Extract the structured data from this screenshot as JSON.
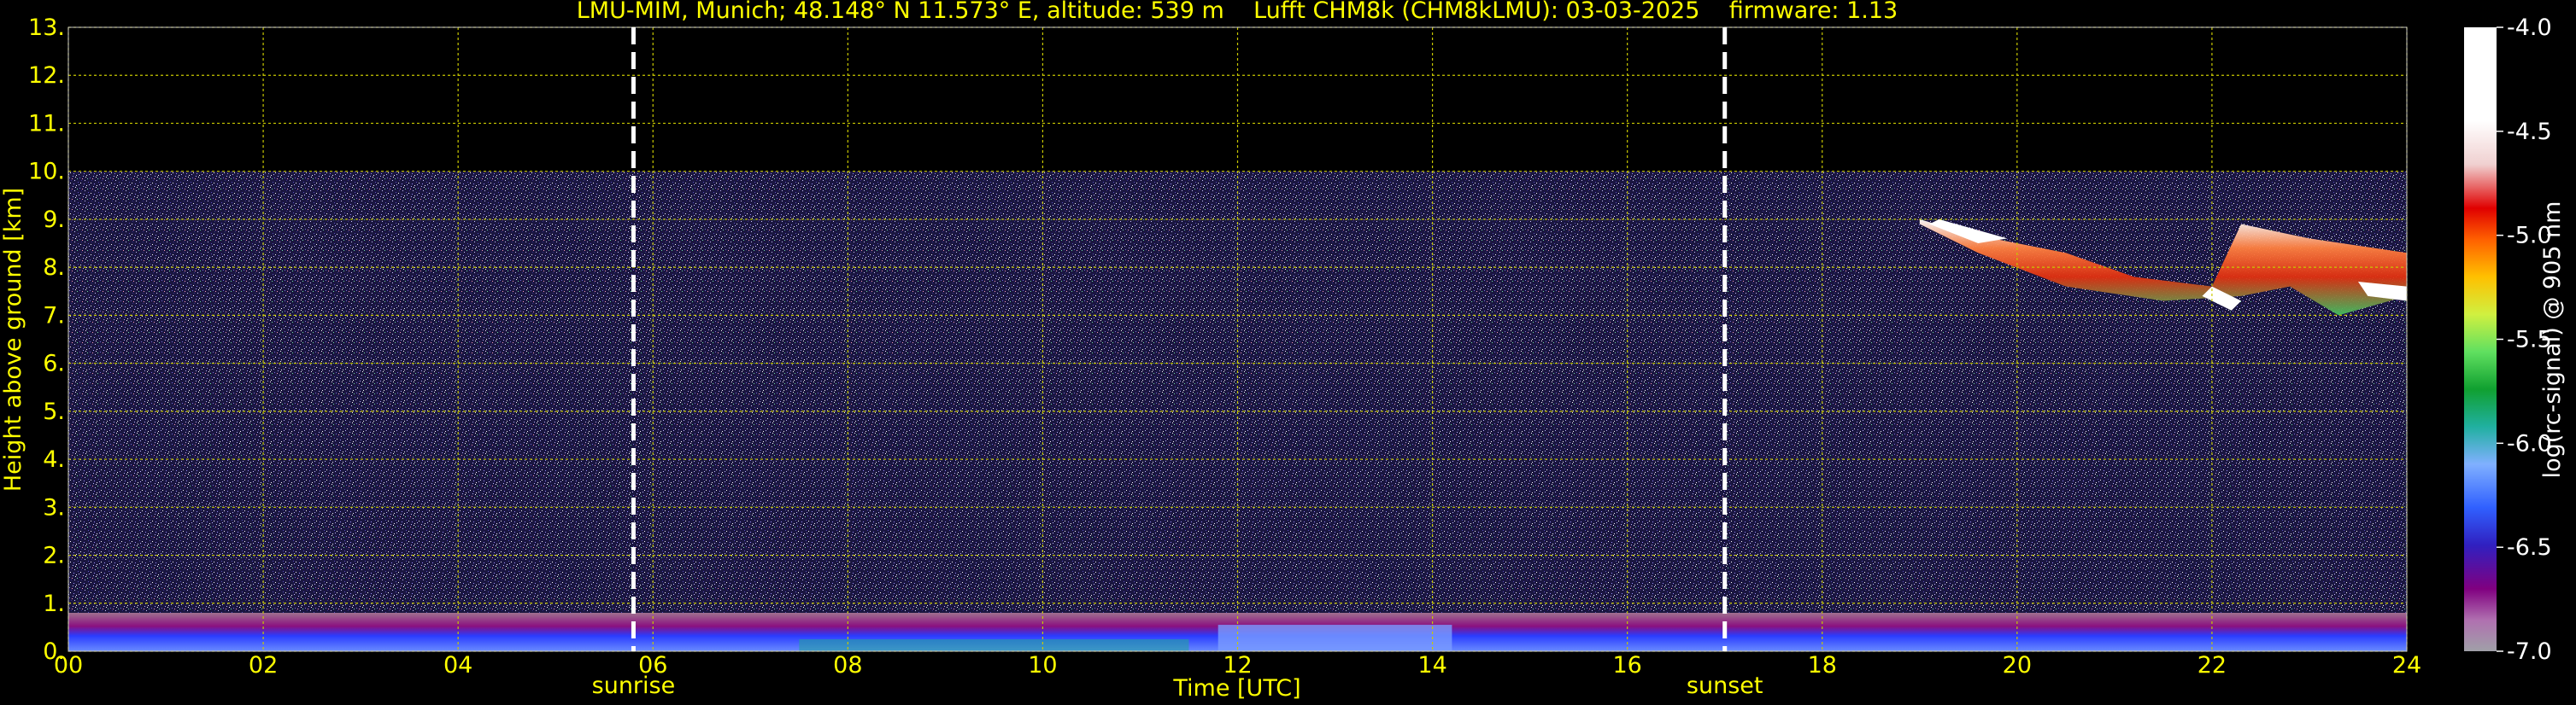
{
  "chart_data": {
    "type": "heatmap",
    "title": "LMU-MIM, Munich; 48.148° N 11.573° E, altitude: 539 m    Lufft CHM8k (CHM8kLMU): 03-03-2025    firmware: 1.13",
    "xlabel": "Time [UTC]",
    "ylabel": "Height above ground [km]",
    "xlim": [
      0,
      24
    ],
    "ylim": [
      0,
      13
    ],
    "x_ticks": [
      "00",
      "02",
      "04",
      "06",
      "08",
      "10",
      "12",
      "14",
      "16",
      "18",
      "20",
      "22",
      "24"
    ],
    "y_ticks": [
      "0.",
      "1.",
      "2.",
      "3.",
      "4.",
      "5.",
      "6.",
      "7.",
      "8.",
      "9.",
      "10.",
      "11.",
      "12.",
      "13."
    ],
    "grid": true,
    "data_top_km": 10,
    "events": [
      {
        "label": "sunrise",
        "time": 5.8
      },
      {
        "label": "sunset",
        "time": 17.0
      }
    ],
    "colorbar": {
      "label": "log(rc-signal) @ 905 nm",
      "ticks": [
        "-4.0",
        "-4.5",
        "-5.0",
        "-5.5",
        "-6.0",
        "-6.5",
        "-7.0"
      ],
      "range": [
        -7.0,
        -4.0
      ]
    },
    "features": [
      {
        "name": "boundary layer",
        "time_range": [
          0,
          24
        ],
        "height_range_km": [
          0,
          0.8
        ]
      },
      {
        "name": "cirrus cloud",
        "time_range": [
          18.9,
          24
        ],
        "height_range_km": [
          7.0,
          9.1
        ]
      }
    ],
    "colors": {
      "text": "#ffff00",
      "grid": "#c8c800",
      "event_lines": "#ffffff",
      "background": "#000000"
    }
  }
}
